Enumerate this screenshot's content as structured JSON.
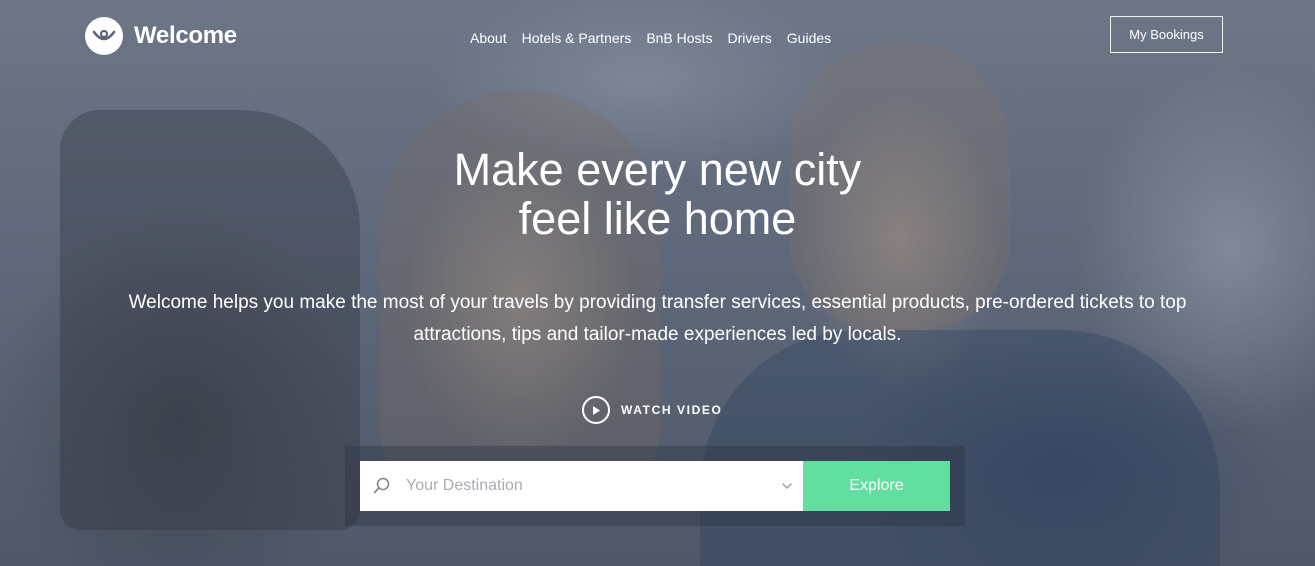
{
  "header": {
    "brand": "Welcome",
    "nav": [
      "About",
      "Hotels & Partners",
      "BnB Hosts",
      "Drivers",
      "Guides"
    ],
    "bookings_label": "My Bookings"
  },
  "hero": {
    "headline_line1": "Make every new city",
    "headline_line2": "feel like home",
    "subtitle": "Welcome helps you make the most of your travels by providing transfer services, essential products, pre-ordered tickets to top attractions, tips and tailor-made experiences led by locals.",
    "watch_label": "WATCH VIDEO"
  },
  "search": {
    "placeholder": "Your Destination",
    "explore_label": "Explore"
  },
  "colors": {
    "accent": "#62dea0",
    "text": "#ffffff"
  },
  "icons": {
    "logo": "welcome-logo-icon",
    "play": "play-icon",
    "search": "search-icon",
    "dropdown": "chevron-down-icon"
  }
}
